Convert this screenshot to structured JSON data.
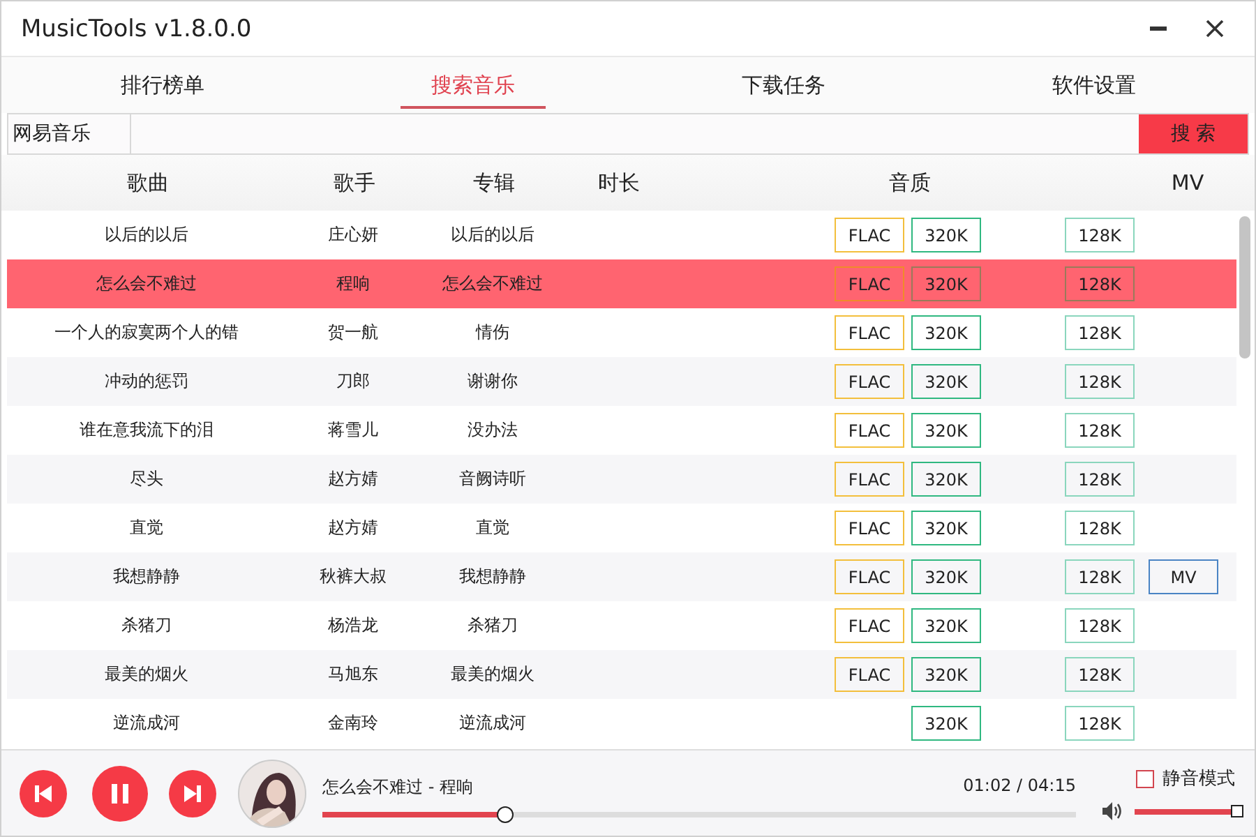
{
  "window": {
    "title": "MusicTools v1.8.0.0"
  },
  "tabs": [
    {
      "label": "排行榜单",
      "selected": false
    },
    {
      "label": "搜索音乐",
      "selected": true
    },
    {
      "label": "下载任务",
      "selected": false
    },
    {
      "label": "软件设置",
      "selected": false
    }
  ],
  "search": {
    "source": "网易音乐",
    "button": "搜 索"
  },
  "table": {
    "columns": [
      "歌曲",
      "歌手",
      "专辑",
      "时长",
      "音质",
      "MV"
    ],
    "rows": [
      {
        "song": "以后的以后",
        "singer": "庄心妍",
        "album": "以后的以后",
        "selected": false,
        "flac": "FLAC",
        "k320": "320K",
        "k128": "128K"
      },
      {
        "song": "怎么会不难过",
        "singer": "程响",
        "album": "怎么会不难过",
        "selected": true,
        "flac": "FLAC",
        "k320": "320K",
        "k128": "128K"
      },
      {
        "song": "一个人的寂寞两个人的错",
        "singer": "贺一航",
        "album": "情伤",
        "selected": false,
        "flac": "FLAC",
        "k320": "320K",
        "k128": "128K"
      },
      {
        "song": "冲动的惩罚",
        "singer": "刀郎",
        "album": "谢谢你",
        "selected": false,
        "flac": "FLAC",
        "k320": "320K",
        "k128": "128K"
      },
      {
        "song": "谁在意我流下的泪",
        "singer": "蒋雪儿",
        "album": "没办法",
        "selected": false,
        "flac": "FLAC",
        "k320": "320K",
        "k128": "128K"
      },
      {
        "song": "尽头",
        "singer": "赵方婧",
        "album": "音阙诗听",
        "selected": false,
        "flac": "FLAC",
        "k320": "320K",
        "k128": "128K"
      },
      {
        "song": "直觉",
        "singer": "赵方婧",
        "album": "直觉",
        "selected": false,
        "flac": "FLAC",
        "k320": "320K",
        "k128": "128K"
      },
      {
        "song": "我想静静",
        "singer": "秋裤大叔",
        "album": "我想静静",
        "selected": false,
        "flac": "FLAC",
        "k320": "320K",
        "k128": "128K",
        "mv": "MV"
      },
      {
        "song": "杀猪刀",
        "singer": "杨浩龙",
        "album": "杀猪刀",
        "selected": false,
        "flac": "FLAC",
        "k320": "320K",
        "k128": "128K"
      },
      {
        "song": "最美的烟火",
        "singer": "马旭东",
        "album": "最美的烟火",
        "selected": false,
        "flac": "FLAC",
        "k320": "320K",
        "k128": "128K"
      },
      {
        "song": "逆流成河",
        "singer": "金南玲",
        "album": "逆流成河",
        "selected": false,
        "k320": "320K",
        "k128": "128K"
      }
    ]
  },
  "player": {
    "now_playing": "怎么会不难过 - 程响",
    "time": "01:02 / 04:15",
    "progress": {
      "level": 0.243
    },
    "mute": {
      "label": "静音模式",
      "checked": false
    },
    "volume": {
      "level": 1.0
    }
  }
}
